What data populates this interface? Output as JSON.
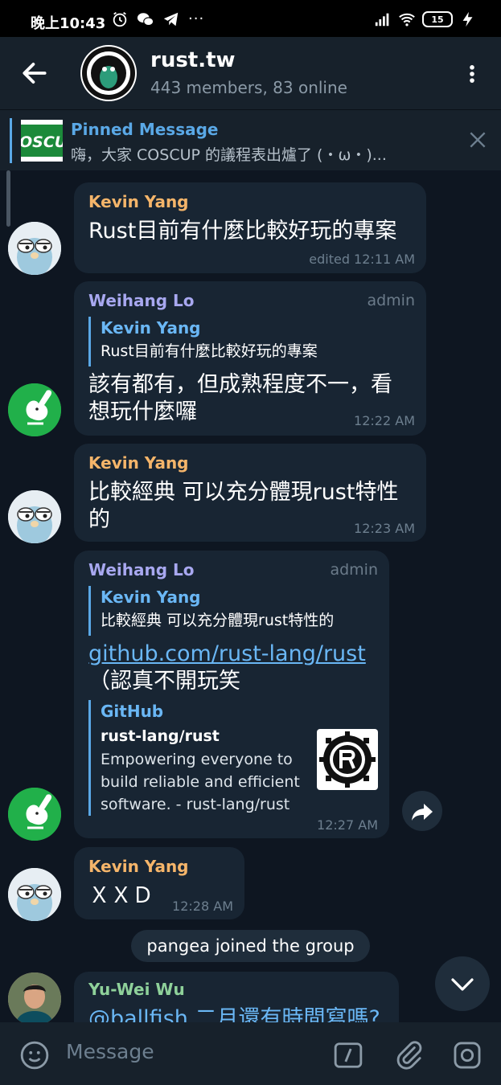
{
  "status_bar": {
    "time": "晚上10:43",
    "more": "···",
    "battery": "15"
  },
  "header": {
    "title": "rust.tw",
    "subtitle": "443 members, 83 online"
  },
  "pinned": {
    "label": "Pinned Message",
    "text": "嗨，大家 COSCUP 的議程表出爐了 (・ω・)...",
    "thumb_text": "OSCU"
  },
  "messages": [
    {
      "sender": "Kevin Yang",
      "text": "Rust目前有什麼比較好玩的專案",
      "time": "edited 12:11 AM"
    },
    {
      "sender": "Weihang Lo",
      "role": "admin",
      "quote_sender": "Kevin Yang",
      "quote_text": "Rust目前有什麼比較好玩的專案",
      "text_line1": "該有都有，但成熟程度不一，看",
      "text_line2": "想玩什麼囉",
      "time": "12:22 AM"
    },
    {
      "sender": "Kevin Yang",
      "text_line1": "比較經典 可以充分體現rust特性",
      "text_line2": "的",
      "time": "12:23 AM"
    },
    {
      "sender": "Weihang Lo",
      "role": "admin",
      "quote_sender": "Kevin Yang",
      "quote_text": "比較經典 可以充分體現rust特性的",
      "link": "github.com/rust-lang/rust",
      "text": "（認真不開玩笑",
      "preview_site": "GitHub",
      "preview_title": "rust-lang/rust",
      "preview_desc": "Empowering everyone to build reliable and efficient software. - rust-lang/rust",
      "time": "12:27 AM"
    },
    {
      "sender": "Kevin Yang",
      "text": "ＸＸＤ",
      "time": "12:28 AM"
    },
    {
      "sender": "Yu-Wei Wu",
      "text": "@ballfish 二月還有時間寫嗎?"
    }
  ],
  "service": "pangea joined the group",
  "composer": {
    "placeholder": "Message"
  },
  "colors": {
    "background": "#0e1621",
    "bubble": "#182533",
    "accent": "#5aa8e6"
  }
}
